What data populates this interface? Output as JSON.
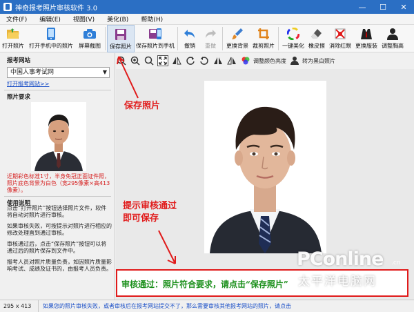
{
  "window": {
    "title": "神奇报考照片审核软件 3.0"
  },
  "menu": [
    "文件(F)",
    "编辑(E)",
    "视图(V)",
    "美化(B)",
    "帮助(H)"
  ],
  "toolbar": [
    {
      "label": "打开照片",
      "icon": "folder-open-icon"
    },
    {
      "label": "打开手机中的照片",
      "icon": "phone-icon"
    },
    {
      "label": "屏幕截图",
      "icon": "camera-icon"
    },
    {
      "label": "保存照片",
      "icon": "save-icon"
    },
    {
      "label": "保存照片到手机",
      "icon": "save-to-phone-icon"
    },
    {
      "label": "撤销",
      "icon": "undo-icon"
    },
    {
      "label": "重做",
      "icon": "redo-icon"
    },
    {
      "label": "更换背景",
      "icon": "brush-icon"
    },
    {
      "label": "裁剪照片",
      "icon": "crop-icon"
    },
    {
      "label": "一键美化",
      "icon": "color-wheel-icon"
    },
    {
      "label": "橡皮擦",
      "icon": "eraser-icon"
    },
    {
      "label": "消除红眼",
      "icon": "red-eye-icon"
    },
    {
      "label": "更换服装",
      "icon": "suit-icon"
    },
    {
      "label": "调整胸高",
      "icon": "body-icon"
    }
  ],
  "toolbar2": {
    "adjust_color": "调整颜色亮度",
    "to_gray": "转为黑白照片"
  },
  "left": {
    "site_title": "报考网站",
    "site_value": "中国人事考试网",
    "site_link": "打开报考网站>>",
    "req_title": "照片要求",
    "req_note": "近期彩色标准1寸，半身免冠正面证件照，照片底色背景为白色（宽295像素×高413像素）。",
    "guide_title": "使用说明",
    "guide": [
      "点击“打开照片”按钮选择照片文件，软件将自动对照片进行审核。",
      "如果审核失败，可按提示对照片进行相应的修改处理直到通过审核。",
      "审核通过后，点击“保存照片”按钮可以将通过后的照片保存到文件中。",
      "报考人员对照片质量负责，如因照片质量影响考试、成绩及证书的，由报考人员负责。"
    ]
  },
  "annotations": {
    "save": "保存照片",
    "pass_tip_1": "提示审核通过",
    "pass_tip_2": "即可保存"
  },
  "result_text": "审核通过：照片符合要求，请点击“保存照片”",
  "status": {
    "dims": "295 x 413",
    "message": "如果您的照片审核失败，或者审核后在报考网站提交不了，那么需要审核其他报考网站的照片，请点击"
  },
  "watermark": {
    "brand": "PConline",
    "sub": "太平洋电脑网",
    "cn": ".cn"
  },
  "colors": {
    "titlebar": "#2b6fc4",
    "accent_red": "#e01a1a",
    "pass_green": "#1a8f1a",
    "link_blue": "#1a4fc7"
  }
}
